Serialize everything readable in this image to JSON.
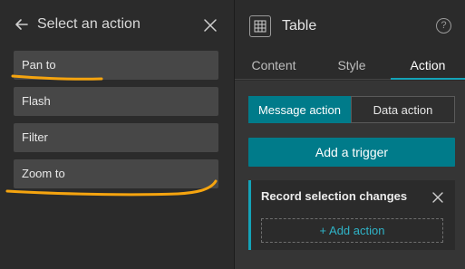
{
  "left_panel": {
    "title": "Select an action",
    "back_icon": "arrow-left-icon",
    "close_icon": "close-icon",
    "actions": [
      {
        "label": "Pan to"
      },
      {
        "label": "Flash"
      },
      {
        "label": "Filter"
      },
      {
        "label": "Zoom to"
      }
    ],
    "annotation_color": "#f5a40f"
  },
  "right_panel": {
    "widget_icon": "table-icon",
    "widget_title": "Table",
    "help_icon": "help-icon",
    "help_glyph": "?",
    "tabs": [
      {
        "label": "Content",
        "active": false
      },
      {
        "label": "Style",
        "active": false
      },
      {
        "label": "Action",
        "active": true
      }
    ],
    "action_types": {
      "message": "Message action",
      "data": "Data action",
      "selected": "Message action"
    },
    "add_trigger_label": "Add a trigger",
    "trigger": {
      "title": "Record selection changes",
      "add_action_label": "+ Add action"
    }
  },
  "colors": {
    "accent": "#007b8a",
    "accent_light": "#14a3b8",
    "background": "#2b2b2b",
    "item_bg": "#474747"
  }
}
